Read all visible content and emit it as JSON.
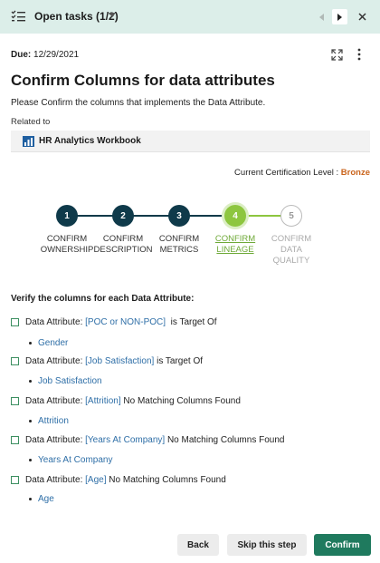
{
  "header": {
    "title": "Open tasks (1/2)",
    "icons": {
      "tasks": "checklist-icon",
      "prev": "chevron-left-icon",
      "next": "chevron-right-icon",
      "close": "close-icon"
    }
  },
  "task": {
    "due_label": "Due:",
    "due_date": "12/29/2021",
    "title": "Confirm Columns for data attributes",
    "description": "Please Confirm the columns that implements the Data Attribute.",
    "related_label": "Related to",
    "related_item": "HR Analytics Workbook",
    "cert_label": "Current Certification Level :",
    "cert_level": "Bronze"
  },
  "steps": [
    {
      "num": "1",
      "label": "CONFIRM\nOWNERSHIP",
      "state": "done"
    },
    {
      "num": "2",
      "label": "CONFIRM\nDESCRIPTION",
      "state": "done"
    },
    {
      "num": "3",
      "label": "CONFIRM\nMETRICS",
      "state": "done"
    },
    {
      "num": "4",
      "label": "CONFIRM\nLINEAGE",
      "state": "active"
    },
    {
      "num": "5",
      "label": "CONFIRM\nDATA\nQUALITY",
      "state": "todo"
    }
  ],
  "verify_heading": "Verify the columns for each Data Attribute:",
  "attributes": [
    {
      "prefix": "Data Attribute:",
      "name": "[POC or NON-POC]",
      "suffix": "is Target Of",
      "column": "Gender"
    },
    {
      "prefix": "Data Attribute:",
      "name": "[Job Satisfaction]",
      "suffix": "is Target Of",
      "column": "Job Satisfaction"
    },
    {
      "prefix": "Data Attribute:",
      "name": "[Attrition]",
      "suffix": "No Matching Columns Found",
      "column": "Attrition"
    },
    {
      "prefix": "Data Attribute:",
      "name": "[Years At Company]",
      "suffix": "No Matching Columns Found",
      "column": "Years At Company"
    },
    {
      "prefix": "Data Attribute:",
      "name": "[Age]",
      "suffix": "No Matching Columns Found",
      "column": "Age"
    }
  ],
  "buttons": {
    "back": "Back",
    "skip": "Skip this step",
    "confirm": "Confirm"
  },
  "colors": {
    "header_bg": "#dceee9",
    "step_done": "#0f3a4a",
    "step_active": "#8dc63f",
    "primary": "#1f7a5e",
    "link": "#2f6fa7",
    "cert": "#c9631b"
  }
}
